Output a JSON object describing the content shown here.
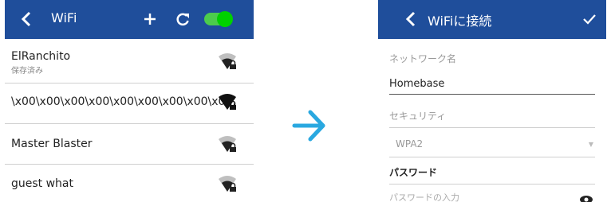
{
  "left_screen": {
    "title": "WiFi",
    "networks": [
      {
        "name": "ElRanchito",
        "status": "保存済み"
      },
      {
        "name": "\\x00\\x00\\x00\\x00\\x00\\x00\\x00\\x00\\x0...",
        "status": ""
      },
      {
        "name": "Master Blaster",
        "status": ""
      },
      {
        "name": "guest what",
        "status": ""
      }
    ],
    "toggle_on": true
  },
  "right_screen": {
    "title": "WiFiに接続",
    "network_name_label": "ネットワーク名",
    "network_name_value": "Homebase",
    "security_label": "セキュリティ",
    "security_value": "WPA2",
    "password_label": "パスワード",
    "password_placeholder": "パスワードの入力"
  },
  "colors": {
    "app_bar": "#1f4e9b",
    "toggle": "#00d100",
    "arrow": "#29a8e0"
  }
}
